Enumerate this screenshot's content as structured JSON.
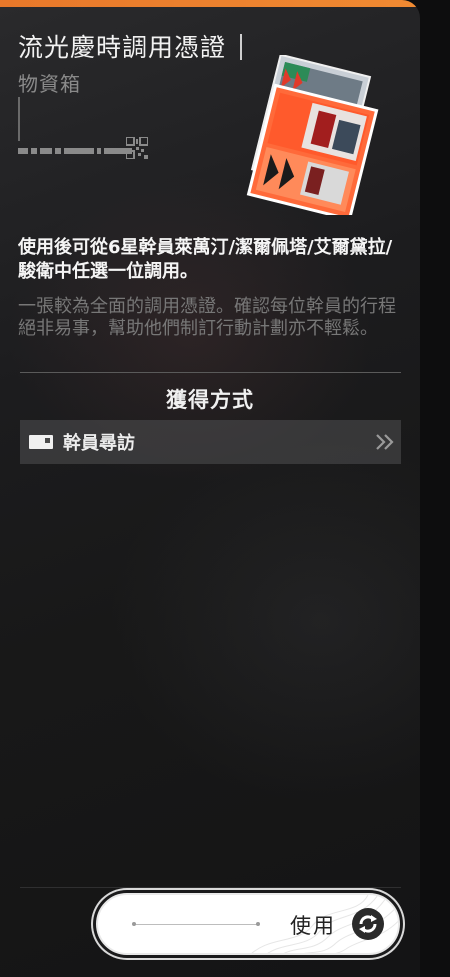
{
  "item": {
    "title": "流光慶時調用憑證",
    "category": "物資箱",
    "description": "使用後可從6星幹員萊萬汀/潔爾佩塔/艾爾黛拉/駿衛中任選一位調用。",
    "flavor_text": "一張較為全面的調用憑證。確認每位幹員的行程絕非易事，幫助他們制訂行動計劃亦不輕鬆。"
  },
  "acquisition": {
    "section_title": "獲得方式",
    "sources": [
      {
        "label": "幹員尋訪",
        "icon": "card-icon",
        "arrow_icon": "double-chevron-right-icon"
      }
    ]
  },
  "actions": {
    "use_label": "使用",
    "use_icon": "cycle-icon"
  },
  "colors": {
    "accent": "#f08a32",
    "panel_bg": "#1c1c1e",
    "text_primary": "#f2f2f2",
    "text_muted": "#777777",
    "art_orange": "#ff5a2c"
  }
}
